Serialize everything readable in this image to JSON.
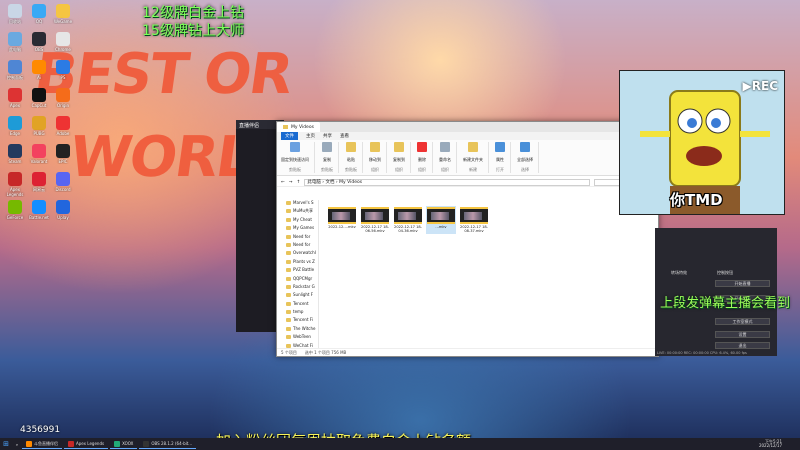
{
  "overlay": {
    "promo_line1": "12级牌白金上钻",
    "promo_line2": "15级牌钻上大师",
    "bottom_promo": "加入粉丝团每周抽取免费白金上钻名额",
    "side_promo": "上段发弹幕主播会看到",
    "cam_rec": "REC",
    "cam_caption": "你TMD",
    "room_id": "4356991"
  },
  "wallpaper_text": {
    "line1": "BEST OR",
    "line2": "WORL"
  },
  "desktop_icons": [
    {
      "label": "回收站",
      "color": "#c9d6e6"
    },
    {
      "label": "QQ",
      "color": "#39a9f5"
    },
    {
      "label": "WeGame",
      "color": "#f5c542"
    },
    {
      "label": "此电脑",
      "color": "#6aa9e0"
    },
    {
      "label": "OBS",
      "color": "#2a2a33"
    },
    {
      "label": "Chrome",
      "color": "#e6e6e6"
    },
    {
      "label": "控制面板",
      "color": "#4f86d4"
    },
    {
      "label": "Ai",
      "color": "#ff8a00"
    },
    {
      "label": "PS",
      "color": "#2b7be4"
    },
    {
      "label": "Apex",
      "color": "#d33"
    },
    {
      "label": "CapCut",
      "color": "#111"
    },
    {
      "label": "Origin",
      "color": "#f56c1a"
    },
    {
      "label": "Edge",
      "color": "#1e9bd7"
    },
    {
      "label": "PUBG",
      "color": "#e1a325"
    },
    {
      "label": "Adobe",
      "color": "#e33"
    },
    {
      "label": "Steam",
      "color": "#243a5e"
    },
    {
      "label": "Valorant",
      "color": "#f3425f"
    },
    {
      "label": "EPIC",
      "color": "#222"
    },
    {
      "label": "Apex Legends",
      "color": "#c62828"
    },
    {
      "label": "网易云",
      "color": "#d23"
    },
    {
      "label": "Discord",
      "color": "#5865f2"
    },
    {
      "label": "GeForce",
      "color": "#76b900"
    },
    {
      "label": "Battle.net",
      "color": "#148eff"
    },
    {
      "label": "Uplay",
      "color": "#2266dd"
    }
  ],
  "launcher": {
    "title": "直播伴侣"
  },
  "explorer": {
    "tab_title": "My Videos",
    "menu": [
      "文件",
      "主页",
      "共享",
      "查看"
    ],
    "ribbon_groups": [
      {
        "label": "固定到快速访问",
        "group": "剪贴板"
      },
      {
        "label": "复制",
        "group": "剪贴板"
      },
      {
        "label": "粘贴",
        "group": "剪贴板"
      },
      {
        "label": "移动到",
        "group": "组织"
      },
      {
        "label": "复制到",
        "group": "组织"
      },
      {
        "label": "删除",
        "group": "组织"
      },
      {
        "label": "重命名",
        "group": "组织"
      },
      {
        "label": "新建文件夹",
        "group": "新建"
      },
      {
        "label": "属性",
        "group": "打开"
      },
      {
        "label": "全部选择",
        "group": "选择"
      }
    ],
    "address_path": "此电脑 › 文档 › My Videos",
    "search_placeholder": "",
    "nav_items": [
      "Marvel's S",
      "MuMu共享",
      "My Cheat",
      "My Games",
      "Need for",
      "Need for",
      "OverwatchI",
      "Plants vs Z",
      "PVZ Battle",
      "QQPCMgr",
      "Rockstar G",
      "Sunlight F",
      "Tencent",
      "temp",
      "Tencent Fi",
      "The Witche",
      "WebTeen",
      "WeChat Fi",
      "XDGAME",
      "Zepui",
      "视频"
    ],
    "files": [
      {
        "name": "2022-12-...mkv",
        "selected": false
      },
      {
        "name": "2022-12-17 18-06-56.mkv",
        "selected": false
      },
      {
        "name": "2022-12-17 18-04-36.mkv",
        "selected": false
      },
      {
        "name": "...mkv",
        "selected": true
      },
      {
        "name": "2022-12-17 18-08-37.mkv",
        "selected": false
      }
    ],
    "status_count": "5 个项目",
    "status_selected": "选中 1 个项目 756 MB"
  },
  "obs": {
    "panels": [
      "转场特效",
      "控制按钮"
    ],
    "buttons": [
      "开始直播",
      "开始录制",
      "工作室模式",
      "设置",
      "退出"
    ],
    "status": "LIVE: 00:00:00  REC: 00:00:00  CPU: 6.4%, 60.00 fps"
  },
  "taskbar": {
    "items": [
      {
        "label": "斗鱼直播伴侣",
        "color": "#ff8a00"
      },
      {
        "label": "Apex Legends",
        "color": "#c62828"
      },
      {
        "label": "XOOX",
        "color": "#2a7"
      },
      {
        "label": "OBS 28.1.2 (64-bit...",
        "color": "#333"
      }
    ],
    "time": "下午5:21",
    "date": "2022/12/17"
  }
}
